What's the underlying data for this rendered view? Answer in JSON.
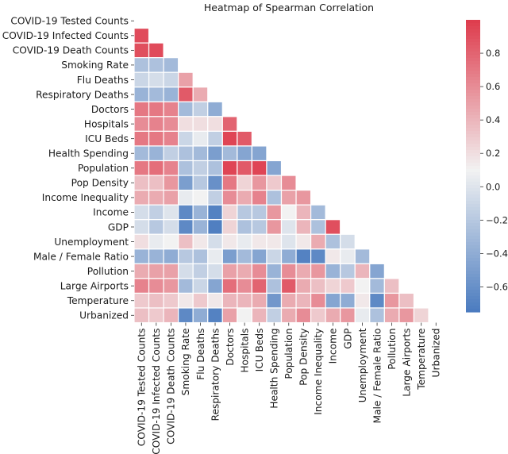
{
  "chart_data": {
    "type": "heatmap",
    "title": "Heatmap of Spearman Correlation",
    "xlabel": "",
    "ylabel": "",
    "mask": "upper-triangle-including-diagonal",
    "variables": [
      "COVID-19 Tested Counts",
      "COVID-19 Infected Counts",
      "COVID-19 Death Counts",
      "Smoking Rate",
      "Flu Deaths",
      "Respiratory Deaths",
      "Doctors",
      "Hospitals",
      "ICU Beds",
      "Health Spending",
      "Population",
      "Pop Density",
      "Income Inequality",
      "Income",
      "GDP",
      "Unemployment",
      "Male / Female Ratio",
      "Pollution",
      "Large Airports",
      "Temperature",
      "Urbanized"
    ],
    "lower_triangle_values": [
      [],
      [
        0.92
      ],
      [
        0.9,
        0.92
      ],
      [
        -0.25,
        -0.25,
        -0.3
      ],
      [
        -0.1,
        -0.05,
        -0.1,
        0.5
      ],
      [
        -0.35,
        -0.3,
        -0.35,
        0.85,
        0.45
      ],
      [
        0.7,
        0.7,
        0.65,
        -0.3,
        -0.15,
        -0.4
      ],
      [
        0.6,
        0.65,
        0.6,
        0.2,
        0.2,
        0.2,
        0.8
      ],
      [
        0.7,
        0.7,
        0.65,
        -0.1,
        0.05,
        -0.15,
        0.95,
        0.85
      ],
      [
        -0.3,
        -0.35,
        -0.15,
        -0.25,
        -0.3,
        -0.5,
        -0.3,
        -0.45,
        -0.45
      ],
      [
        0.7,
        0.75,
        0.65,
        -0.25,
        -0.15,
        -0.25,
        0.95,
        0.85,
        0.95,
        -0.45
      ],
      [
        0.35,
        0.35,
        0.55,
        -0.5,
        -0.2,
        -0.6,
        0.7,
        0.25,
        0.55,
        0.3,
        0.6
      ],
      [
        0.45,
        0.45,
        0.5,
        0.05,
        0.1,
        -0.15,
        0.6,
        0.45,
        0.65,
        -0.25,
        0.5,
        0.55
      ],
      [
        -0.05,
        -0.15,
        0.0,
        -0.65,
        -0.35,
        -0.7,
        0.25,
        -0.2,
        -0.2,
        0.55,
        0.1,
        0.4,
        -0.3
      ],
      [
        -0.05,
        -0.2,
        -0.05,
        -0.65,
        -0.35,
        -0.72,
        0.25,
        -0.25,
        -0.2,
        0.55,
        0.0,
        0.4,
        -0.25,
        0.9
      ],
      [
        0.2,
        0.05,
        0.1,
        0.35,
        0.15,
        -0.05,
        0.15,
        0.05,
        0.15,
        0.15,
        0.0,
        0.15,
        0.45,
        -0.25,
        -0.05
      ],
      [
        -0.35,
        -0.35,
        -0.4,
        -0.2,
        -0.25,
        0.05,
        -0.5,
        -0.3,
        -0.45,
        -0.1,
        -0.4,
        -0.7,
        -0.65,
        0.15,
        0.05,
        -0.3
      ],
      [
        0.45,
        0.5,
        0.5,
        -0.05,
        -0.15,
        -0.05,
        0.5,
        0.45,
        0.6,
        -0.35,
        0.6,
        0.45,
        0.55,
        -0.35,
        -0.2,
        0.4,
        -0.45
      ],
      [
        0.65,
        0.6,
        0.55,
        -0.3,
        -0.1,
        -0.45,
        0.75,
        0.6,
        0.8,
        -0.25,
        0.85,
        0.45,
        0.35,
        0.25,
        0.3,
        0.1,
        -0.3,
        0.35
      ],
      [
        0.3,
        0.35,
        0.3,
        0.15,
        0.3,
        0.15,
        0.4,
        0.4,
        0.45,
        -0.55,
        0.45,
        0.4,
        0.6,
        -0.45,
        -0.4,
        0.15,
        -0.65,
        0.55,
        0.35
      ],
      [
        0.35,
        0.3,
        0.4,
        -0.65,
        -0.4,
        -0.7,
        0.5,
        0.1,
        0.4,
        -0.15,
        0.45,
        0.6,
        0.3,
        0.45,
        0.55,
        0.05,
        -0.25,
        0.45,
        0.55,
        0.25
      ]
    ],
    "colorbar": {
      "range": [
        -0.75,
        1.0
      ],
      "center": 0.1,
      "ticks": [
        0.8,
        0.6,
        0.4,
        0.2,
        0.0,
        -0.2,
        -0.4,
        -0.6
      ],
      "tick_labels": [
        "0.8",
        "0.6",
        "0.4",
        "0.2",
        "0.0",
        "−0.2",
        "−0.4",
        "−0.6"
      ],
      "position": "right"
    },
    "colors": {
      "low": "#4a7bbf",
      "mid": "#f2f2f2",
      "high": "#de3b4c"
    },
    "grid": false,
    "legend": "colorbar-right"
  }
}
